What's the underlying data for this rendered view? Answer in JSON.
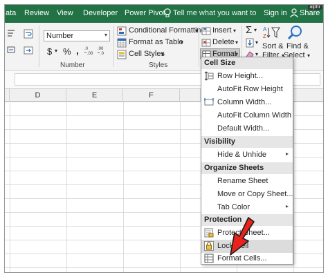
{
  "tabs": {
    "data": "ata",
    "review": "Review",
    "view": "View",
    "developer": "Developer",
    "power_pivot": "Power Pivot",
    "tell_me": "Tell me what you want to do",
    "sign_in": "Sign in",
    "share": "Share",
    "watermark": "alphr"
  },
  "ribbon": {
    "number_format": "Number",
    "currency": "$",
    "percent": "%",
    "comma": ",",
    "number_group": "Number",
    "conditional_formatting": "Conditional Formatting",
    "format_as_table": "Format as Table",
    "cell_styles": "Cell Styles",
    "styles_group": "Styles",
    "insert": "Insert",
    "delete": "Delete",
    "format": "Format",
    "sort_filter_1": "Sort &",
    "sort_filter_2": "Filter",
    "find_select_1": "Find &",
    "find_select_2": "Select",
    "dropdown_glyph": "▾"
  },
  "columns": [
    "D",
    "E",
    "F"
  ],
  "menu": {
    "cell_size_header": "Cell Size",
    "row_height": "Row Height...",
    "autofit_row_height": "AutoFit Row Height",
    "column_width": "Column Width...",
    "autofit_column_width": "AutoFit Column Width",
    "default_width": "Default Width...",
    "visibility_header": "Visibility",
    "hide_unhide": "Hide & Unhide",
    "organize_sheets_header": "Organize Sheets",
    "rename_sheet": "Rename Sheet",
    "move_copy_sheet": "Move or Copy Sheet...",
    "tab_color": "Tab Color",
    "protection_header": "Protection",
    "protect_sheet": "Protect Sheet...",
    "lock_cell": "Lock Cell",
    "format_cells": "Format Cells...",
    "submenu_arrow": "▸"
  },
  "colors": {
    "excel_green": "#217346",
    "menu_header": "#e6e6e6",
    "arrow_red": "#e8231b"
  }
}
